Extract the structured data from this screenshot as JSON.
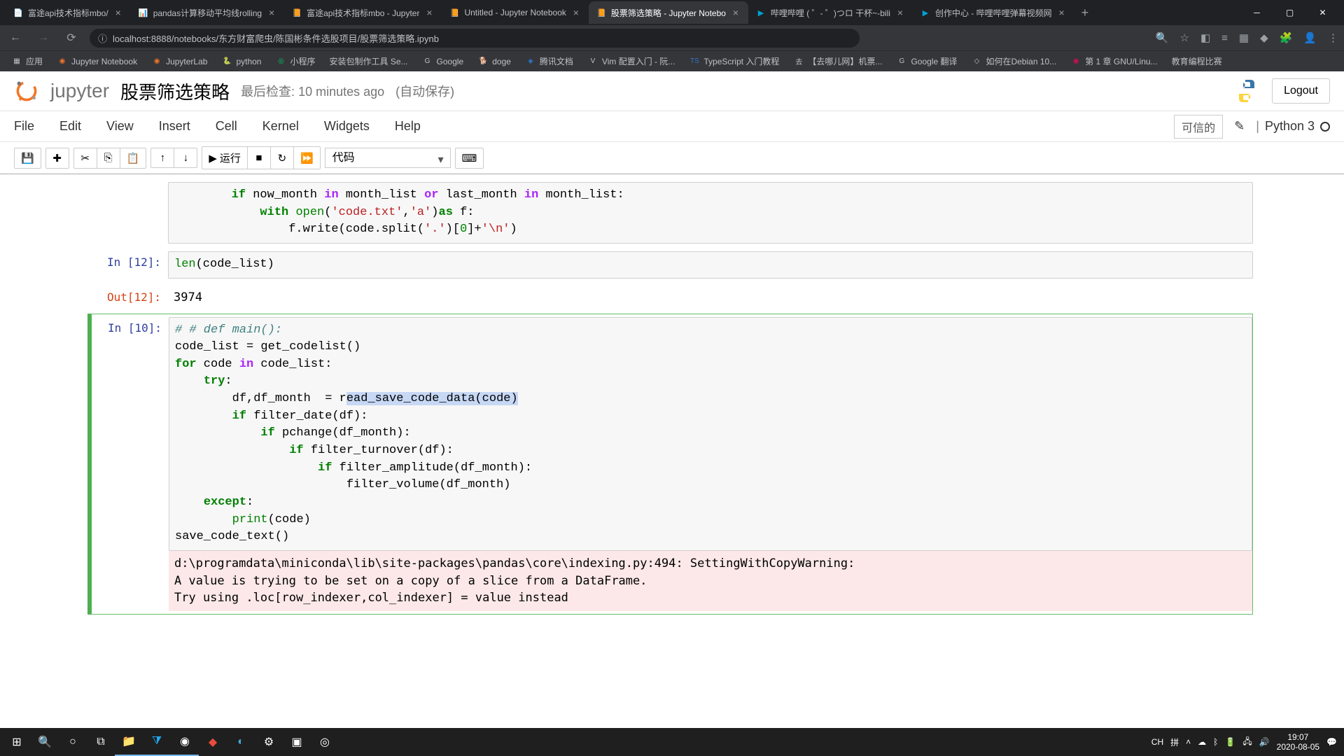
{
  "browser": {
    "tabs": [
      {
        "title": "富途api技术指标mbo/"
      },
      {
        "title": "pandas计算移动平均线rolling"
      },
      {
        "title": "富途api技术指标mbo - Jupyter"
      },
      {
        "title": "Untitled - Jupyter Notebook"
      },
      {
        "title": "股票筛选策略 - Jupyter Notebo"
      },
      {
        "title": "哔哩哔哩 ( ゜- ゜)つロ 干杯~-bili"
      },
      {
        "title": "创作中心 - 哔哩哔哩弹幕视频网"
      }
    ],
    "url": "localhost:8888/notebooks/东方财富爬虫/陈国彬条件选股项目/股票筛选策略.ipynb",
    "bookmarks": [
      {
        "label": "应用"
      },
      {
        "label": "Jupyter Notebook"
      },
      {
        "label": "JupyterLab"
      },
      {
        "label": "python"
      },
      {
        "label": "小程序"
      },
      {
        "label": "安装包制作工具 Se..."
      },
      {
        "label": "Google"
      },
      {
        "label": "doge"
      },
      {
        "label": "腾讯文档"
      },
      {
        "label": "Vim 配置入门 - 阮..."
      },
      {
        "label": "TypeScript 入门教程"
      },
      {
        "label": "【去哪儿网】机票..."
      },
      {
        "label": "Google 翻译"
      },
      {
        "label": "如何在Debian 10..."
      },
      {
        "label": "第 1 章 GNU/Linu..."
      },
      {
        "label": "教育编程比赛"
      }
    ]
  },
  "notebook": {
    "brand": "jupyter",
    "title": "股票筛选策略",
    "checkpoint": "最后检查: 10 minutes ago",
    "autosave": "(自动保存)",
    "logout": "Logout",
    "menu": [
      "File",
      "Edit",
      "View",
      "Insert",
      "Cell",
      "Kernel",
      "Widgets",
      "Help"
    ],
    "trusted": "可信的",
    "kernel": "Python 3",
    "run_label": "运行",
    "cell_type": "代码"
  },
  "cells": {
    "c0_code_l1_pre": "        ",
    "c0_code_l1_if": "if",
    "c0_code_l1_a": " now_month ",
    "c0_code_l1_in1": "in",
    "c0_code_l1_b": " month_list ",
    "c0_code_l1_or": "or",
    "c0_code_l1_c": " last_month ",
    "c0_code_l1_in2": "in",
    "c0_code_l1_d": " month_list:",
    "c0_code_l2_pre": "            ",
    "c0_code_l2_with": "with",
    "c0_code_l2_sp": " ",
    "c0_code_l2_open": "open",
    "c0_code_l2_p1": "(",
    "c0_code_l2_s1": "'code.txt'",
    "c0_code_l2_c1": ",",
    "c0_code_l2_s2": "'a'",
    "c0_code_l2_p2": ")",
    "c0_code_l2_as": "as",
    "c0_code_l2_e": " f:",
    "c0_code_l3_pre": "                f.write(code.split(",
    "c0_code_l3_s1": "'.'",
    "c0_code_l3_mid": ")[",
    "c0_code_l3_n": "0",
    "c0_code_l3_mid2": "]+",
    "c0_code_l3_s2": "'\\n'",
    "c0_code_l3_end": ")",
    "c1_prompt": "In [12]:",
    "c1_len": "len",
    "c1_rest": "(code_list)",
    "c1_out_prompt": "Out[12]:",
    "c1_out": "3974",
    "c2_prompt": "In [10]:",
    "c2_l1_cm": "# # def main():",
    "c2_l2": "code_list = get_codelist()",
    "c2_l3_for": "for",
    "c2_l3_a": " code ",
    "c2_l3_in": "in",
    "c2_l3_b": " code_list:",
    "c2_l4_pre": "    ",
    "c2_l4_try": "try",
    "c2_l4_c": ":",
    "c2_l5_pre": "        df,df_month  = r",
    "c2_l5_hl": "ead_save_code_data(code)",
    "c2_l6_pre": "        ",
    "c2_l6_if": "if",
    "c2_l6_r": " filter_date(df):",
    "c2_l7_pre": "            ",
    "c2_l7_if": "if",
    "c2_l7_r": " pchange(df_month):",
    "c2_l8_pre": "                ",
    "c2_l8_if": "if",
    "c2_l8_r": " filter_turnover(df):",
    "c2_l9_pre": "                    ",
    "c2_l9_if": "if",
    "c2_l9_r": " filter_amplitude(df_month):",
    "c2_l10": "                        filter_volume(df_month)",
    "c2_l11_pre": "    ",
    "c2_l11_ex": "except",
    "c2_l11_c": ":",
    "c2_l12_pre": "        ",
    "c2_l12_print": "print",
    "c2_l12_r": "(code)",
    "c2_l13": "save_code_text()",
    "c2_warn": "d:\\programdata\\miniconda\\lib\\site-packages\\pandas\\core\\indexing.py:494: SettingWithCopyWarning: \nA value is trying to be set on a copy of a slice from a DataFrame.\nTry using .loc[row_indexer,col_indexer] = value instead"
  },
  "taskbar": {
    "ime": "CH",
    "kb": "拼",
    "time": "19:07",
    "date": "2020-08-05"
  }
}
